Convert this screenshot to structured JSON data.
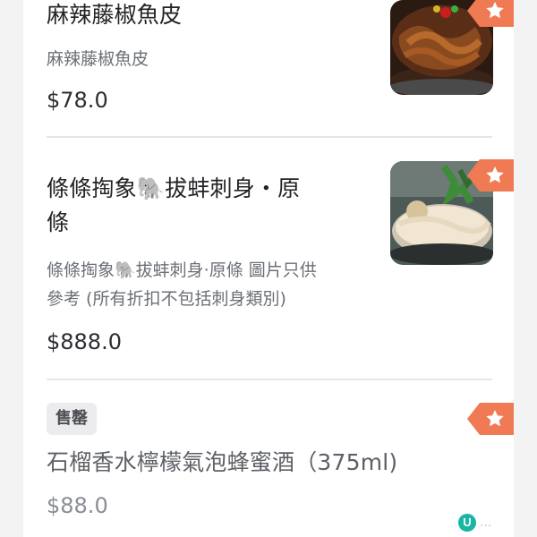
{
  "menu": {
    "items": [
      {
        "title": "麻辣藤椒魚皮",
        "description": "麻辣藤椒魚皮",
        "price": "$78.0",
        "icon": "star-icon"
      },
      {
        "title_line1": "條條掏象🐘拔蚌刺身・原",
        "title_line2": "條",
        "description_line1": "條條掏象🐘拔蚌刺身·原條 圖片只供",
        "description_line2": "參考 (所有折扣不包括刺身類別)",
        "price": "$888.0",
        "icon": "star-icon"
      },
      {
        "status": "售罄",
        "title": "石榴香水檸檬氣泡蜂蜜酒（375ml)",
        "price": "$88.0",
        "icon": "star-icon"
      }
    ]
  },
  "watermark": {
    "logo_letter": "U",
    "text": "..."
  },
  "colors": {
    "accent": "#f07a54",
    "background": "#f3f3f4",
    "card": "#ffffff",
    "divider": "#e6e6e8"
  }
}
